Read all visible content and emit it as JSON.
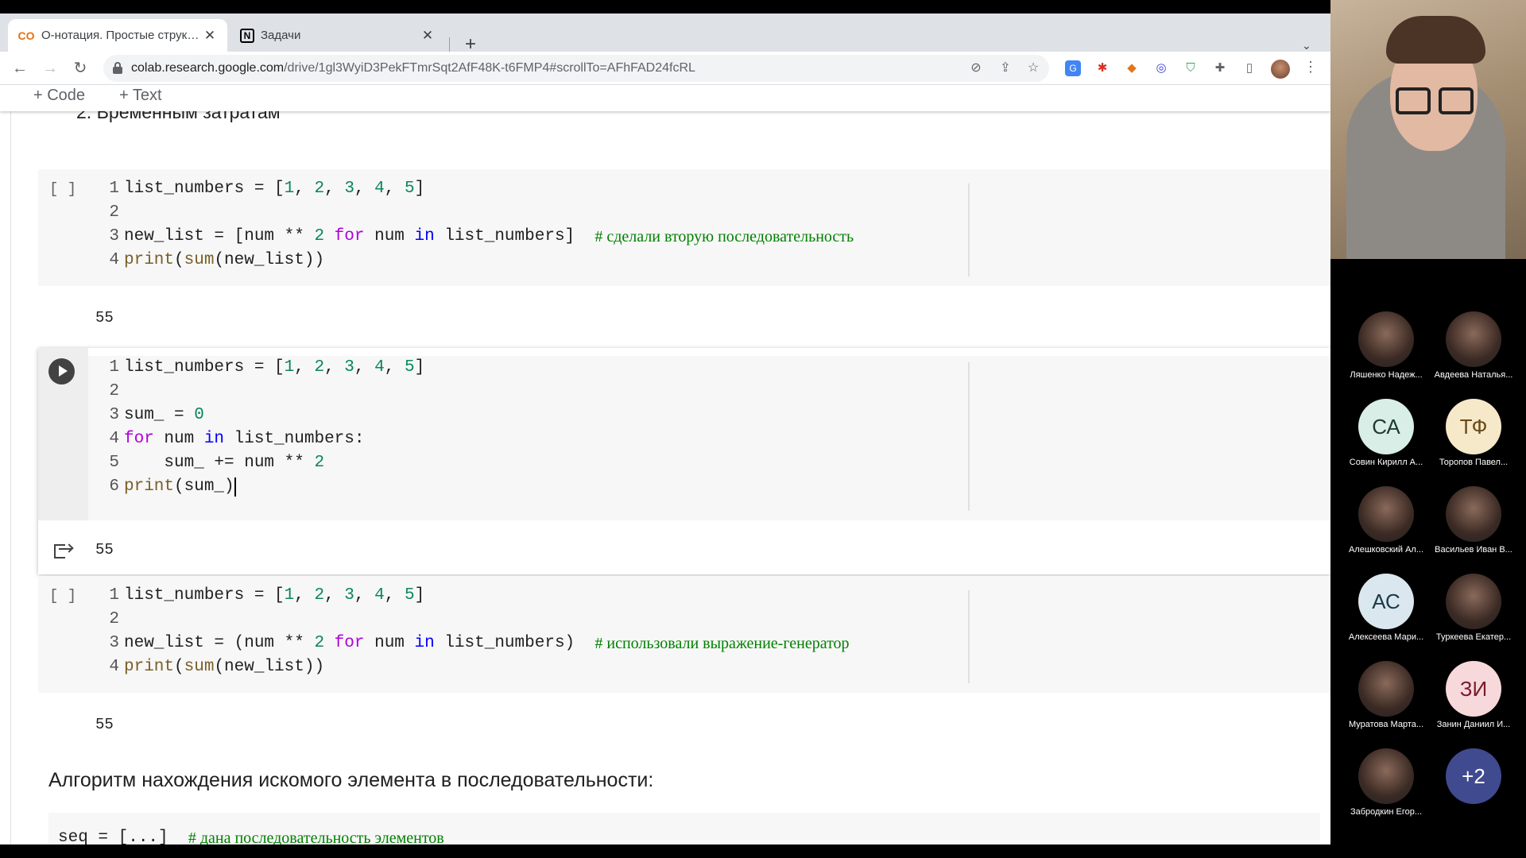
{
  "browser": {
    "tabs": [
      {
        "title": "О-нотация. Простые структуры данных",
        "favicon": "colab-icon",
        "active": true
      },
      {
        "title": "Задачи",
        "favicon": "notion-icon",
        "active": false
      }
    ],
    "new_tab_label": "+",
    "url_host": "colab.research.google.com",
    "url_path": "/drive/1gl3WyiD3PekFTmrSqt2AfF48K-t6FMP4#scrollTo=AFhFAD24fcRL"
  },
  "colab": {
    "add_code_label": "+ Code",
    "add_text_label": "+ Text",
    "partial_heading": "2. Временным затратам",
    "cells": [
      {
        "exec_label": "[ ]",
        "lines": [
          {
            "n": "1",
            "tokens": [
              {
                "t": "list_numbers ",
                "c": "text"
              },
              {
                "t": "=",
                "c": "text"
              },
              {
                "t": " [",
                "c": "text"
              },
              {
                "t": "1",
                "c": "num"
              },
              {
                "t": ", ",
                "c": "text"
              },
              {
                "t": "2",
                "c": "num"
              },
              {
                "t": ", ",
                "c": "text"
              },
              {
                "t": "3",
                "c": "num"
              },
              {
                "t": ", ",
                "c": "text"
              },
              {
                "t": "4",
                "c": "num"
              },
              {
                "t": ", ",
                "c": "text"
              },
              {
                "t": "5",
                "c": "num"
              },
              {
                "t": "]",
                "c": "text"
              }
            ]
          },
          {
            "n": "2",
            "tokens": []
          },
          {
            "n": "3",
            "tokens": [
              {
                "t": "new_list = [num ** ",
                "c": "text"
              },
              {
                "t": "2",
                "c": "num"
              },
              {
                "t": " ",
                "c": "text"
              },
              {
                "t": "for",
                "c": "kw"
              },
              {
                "t": " num ",
                "c": "text"
              },
              {
                "t": "in",
                "c": "op"
              },
              {
                "t": " list_numbers]  ",
                "c": "text"
              },
              {
                "t": "# сделали вторую последовательность",
                "c": "cm"
              }
            ]
          },
          {
            "n": "4",
            "tokens": [
              {
                "t": "print",
                "c": "fn"
              },
              {
                "t": "(",
                "c": "text"
              },
              {
                "t": "sum",
                "c": "fn"
              },
              {
                "t": "(new_list))",
                "c": "text"
              }
            ]
          }
        ],
        "output": "55"
      },
      {
        "exec_label": "",
        "lines": [
          {
            "n": "1",
            "tokens": [
              {
                "t": "list_numbers = [",
                "c": "text"
              },
              {
                "t": "1",
                "c": "num"
              },
              {
                "t": ", ",
                "c": "text"
              },
              {
                "t": "2",
                "c": "num"
              },
              {
                "t": ", ",
                "c": "text"
              },
              {
                "t": "3",
                "c": "num"
              },
              {
                "t": ", ",
                "c": "text"
              },
              {
                "t": "4",
                "c": "num"
              },
              {
                "t": ", ",
                "c": "text"
              },
              {
                "t": "5",
                "c": "num"
              },
              {
                "t": "]",
                "c": "text"
              }
            ]
          },
          {
            "n": "2",
            "tokens": []
          },
          {
            "n": "3",
            "tokens": [
              {
                "t": "sum_ = ",
                "c": "text"
              },
              {
                "t": "0",
                "c": "num"
              }
            ]
          },
          {
            "n": "4",
            "tokens": [
              {
                "t": "for",
                "c": "kw"
              },
              {
                "t": " num ",
                "c": "text"
              },
              {
                "t": "in",
                "c": "op"
              },
              {
                "t": " list_numbers:",
                "c": "text"
              }
            ]
          },
          {
            "n": "5",
            "tokens": [
              {
                "t": "    sum_ += num ** ",
                "c": "text"
              },
              {
                "t": "2",
                "c": "num"
              }
            ]
          },
          {
            "n": "6",
            "tokens": [
              {
                "t": "print",
                "c": "fn"
              },
              {
                "t": "(sum_)",
                "c": "text"
              }
            ]
          }
        ],
        "output": "55"
      },
      {
        "exec_label": "[ ]",
        "lines": [
          {
            "n": "1",
            "tokens": [
              {
                "t": "list_numbers = [",
                "c": "text"
              },
              {
                "t": "1",
                "c": "num"
              },
              {
                "t": ", ",
                "c": "text"
              },
              {
                "t": "2",
                "c": "num"
              },
              {
                "t": ", ",
                "c": "text"
              },
              {
                "t": "3",
                "c": "num"
              },
              {
                "t": ", ",
                "c": "text"
              },
              {
                "t": "4",
                "c": "num"
              },
              {
                "t": ", ",
                "c": "text"
              },
              {
                "t": "5",
                "c": "num"
              },
              {
                "t": "]",
                "c": "text"
              }
            ]
          },
          {
            "n": "2",
            "tokens": []
          },
          {
            "n": "3",
            "tokens": [
              {
                "t": "new_list = (num ** ",
                "c": "text"
              },
              {
                "t": "2",
                "c": "num"
              },
              {
                "t": " ",
                "c": "text"
              },
              {
                "t": "for",
                "c": "kw"
              },
              {
                "t": " num ",
                "c": "text"
              },
              {
                "t": "in",
                "c": "op"
              },
              {
                "t": " list_numbers)  ",
                "c": "text"
              },
              {
                "t": "# использовали выражение-генератор",
                "c": "cm"
              }
            ]
          },
          {
            "n": "4",
            "tokens": [
              {
                "t": "print",
                "c": "fn"
              },
              {
                "t": "(",
                "c": "text"
              },
              {
                "t": "sum",
                "c": "fn"
              },
              {
                "t": "(new_list))",
                "c": "text"
              }
            ]
          }
        ],
        "output": "55"
      }
    ],
    "section_text": "Алгоритм нахождения искомого элемента в последовательности:",
    "bottom_code": [
      {
        "t": "seq = [...]  ",
        "c": "text"
      },
      {
        "t": "# дана последовательность элементов",
        "c": "cm"
      }
    ]
  },
  "call": {
    "participants": [
      {
        "name": "Ляшенко Надеж...",
        "initials": "",
        "bg": "#6b2a3a",
        "photo": true
      },
      {
        "name": "Авдеева Наталья...",
        "initials": "",
        "bg": "#d8d8d8",
        "photo": true
      },
      {
        "name": "Совин Кирилл А...",
        "initials": "СА",
        "bg": "#d8eee6",
        "fg": "#1f3a33",
        "photo": false
      },
      {
        "name": "Торопов Павел...",
        "initials": "ТФ",
        "bg": "#f6e9c9",
        "fg": "#6a4a1a",
        "photo": false
      },
      {
        "name": "Алешковский Ал...",
        "initials": "",
        "bg": "#3a2a1a",
        "photo": true
      },
      {
        "name": "Васильев Иван В...",
        "initials": "",
        "bg": "#c9f2d8",
        "photo": true
      },
      {
        "name": "Алексеева Мари...",
        "initials": "АС",
        "bg": "#dbe7ef",
        "fg": "#1a3a4a",
        "photo": false
      },
      {
        "name": "Туркеева Екатер...",
        "initials": "",
        "bg": "#e9cbbd",
        "photo": true
      },
      {
        "name": "Муратова Марта...",
        "initials": "",
        "bg": "#888888",
        "photo": true
      },
      {
        "name": "Занин Даниил И...",
        "initials": "ЗИ",
        "bg": "#f7d9dc",
        "fg": "#7a1a2a",
        "photo": false
      },
      {
        "name": "Забродкин Егор...",
        "initials": "",
        "bg": "#5a3a2a",
        "photo": true
      },
      {
        "name": "",
        "initials": "+2",
        "bg": "#3f4a8f",
        "fg": "#ffffff",
        "photo": false
      }
    ]
  }
}
